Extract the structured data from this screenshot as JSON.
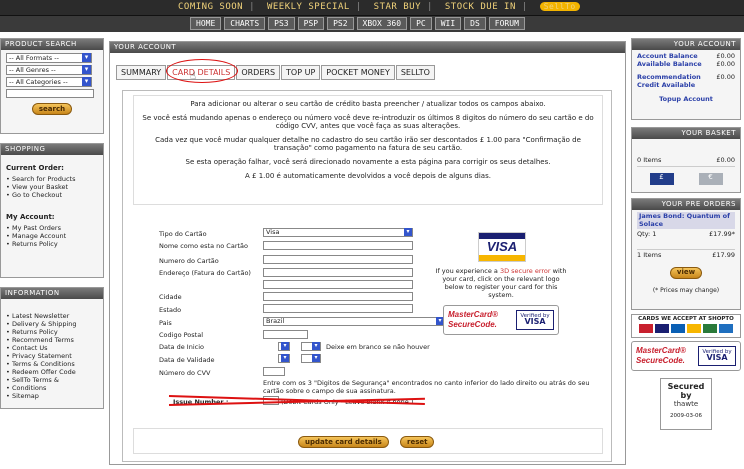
{
  "top_nav": {
    "links": [
      "COMING SOON",
      "WEEKLY SPECIAL",
      "STAR BUY",
      "STOCK DUE IN"
    ],
    "logo": "SellTo"
  },
  "nav_tabs": [
    "HOME",
    "CHARTS",
    "PS3",
    "PSP",
    "PS2",
    "XBOX 360",
    "PC",
    "WII",
    "DS",
    "FORUM"
  ],
  "product_search": {
    "title": "PRODUCT SEARCH",
    "formats": "-- All Formats --",
    "genres": "-- All Genres --",
    "categories": "-- All Categories --",
    "button": "search"
  },
  "shopping": {
    "title": "SHOPPING",
    "current_order_heading": "Current Order:",
    "current_order_links": [
      "Search for Products",
      "View your Basket",
      "Go to Checkout"
    ],
    "my_account_heading": "My Account:",
    "my_account_links": [
      "My Past Orders",
      "Manage Account",
      "Returns Policy"
    ]
  },
  "information": {
    "title": "INFORMATION",
    "links": [
      "Latest Newsletter",
      "Delivery & Shipping",
      "Returns Policy",
      "Recommend Terms",
      "Contact Us",
      "Privacy Statement",
      "Terms & Conditions",
      "Redeem Offer Code",
      "SellTo Terms &",
      "Conditions",
      "Sitemap"
    ]
  },
  "main": {
    "title": "YOUR ACCOUNT",
    "tabs": [
      "SUMMARY",
      "CARD DETAILS",
      "ORDERS",
      "TOP UP",
      "POCKET MONEY",
      "SELLTO"
    ],
    "intro": [
      "Para adicionar ou alterar o seu cartão de crédito basta preencher / atualizar todos os campos abaixo.",
      "Se você está mudando apenas o endereço ou número você deve re-introduzir os últimos 8 digitos do número do seu cartão e do código CVV, antes que você faça as suas alterações.",
      "Cada vez que você mudar qualquer detalhe no cadastro do seu cartão irão ser descontados  £ 1.00 para \"Confirmação de transação\" como pagamento na fatura de seu cartão.",
      "Se esta operação falhar, você será direcionado novamente a esta página para corrigir os seus detalhes.",
      "A £ 1.00 é automaticamente devolvidos a você depois de alguns dias."
    ],
    "form": {
      "card_type_label": "Tipo do Cartão",
      "card_type_value": "Visa",
      "name_label": "Nome como esta no Cartão",
      "number_label": "Numero do Cartão",
      "address_label": "Endereço (Fatura do Cartão)",
      "city_label": "Cidade",
      "state_label": "Estado",
      "country_label": "Pais",
      "country_value": "Brazil",
      "postcode_label": "Codigo Postal",
      "start_label": "Data de Inicio",
      "start_hint": "Deixe em branco se não houver",
      "expiry_label": "Data de Validade",
      "cvv_label": "Número do CVV",
      "cvv_hint": "Entre com os 3 \"Digitos de Segurança\" encontrados no canto inferior do lado direito ou atrás do seu cartão sobre o campo de sua assinatura.",
      "issue_label": "Issue Number :",
      "issue_hint": "(Debit Cards Only - Leave blank if none.)"
    },
    "secure_text_1": "If you experience a",
    "secure_text_link": "3D secure error",
    "secure_text_2": "with your card, click on the relevant logo below to register your card for this system.",
    "update_button": "update card details",
    "reset_button": "reset"
  },
  "right": {
    "account_title": "YOUR ACCOUNT",
    "account_balance_label": "Account Balance",
    "account_balance": "£0.00",
    "available_balance_label": "Available Balance",
    "available_balance": "£0.00",
    "recommendation_label": "Recommendation Credit Available",
    "recommendation_value": "£0.00",
    "topup_link": "Topup Account",
    "basket_title": "YOUR BASKET",
    "basket_items": "0 Items",
    "basket_total": "£0.00",
    "basket_flag1": "£",
    "basket_flag2": "€",
    "preorders_title": "YOUR PRE ORDERS",
    "preorder_item": "James Bond: Quantum of Solace",
    "preorder_qty": "Qty: 1",
    "preorder_price": "£17.99*",
    "preorder_count": "1 Items",
    "preorder_total": "£17.99",
    "view_button": "view",
    "price_note": "(* Prices may change)",
    "cards_title": "CARDS WE ACCEPT AT SHOPTO",
    "thawte_top": "Secured",
    "thawte_by": "by",
    "thawte_name": "thawte",
    "thawte_date": "2009-03-06"
  },
  "colors": {
    "accent_gold": "#f0d27a",
    "link_blue": "#2a3fa8",
    "annotation_red": "#dd1111"
  }
}
